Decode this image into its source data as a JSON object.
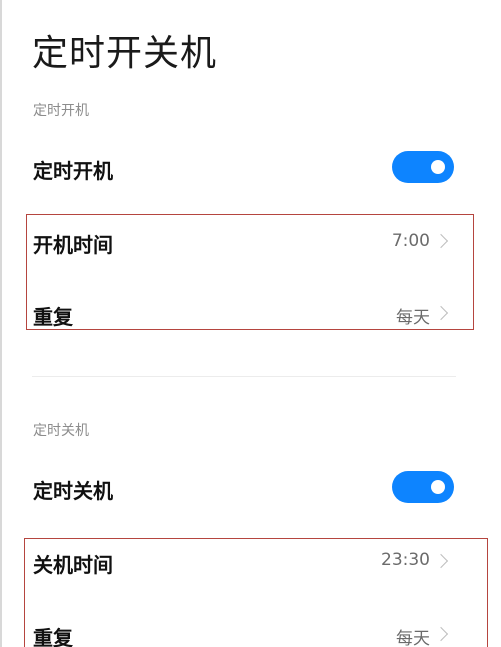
{
  "page": {
    "title": "定时开关机"
  },
  "power_on": {
    "section_label": "定时开机",
    "toggle_label": "定时开机",
    "toggle_enabled": true,
    "time_label": "开机时间",
    "time_value": "7:00",
    "repeat_label": "重复",
    "repeat_value": "每天"
  },
  "power_off": {
    "section_label": "定时关机",
    "toggle_label": "定时关机",
    "toggle_enabled": true,
    "time_label": "关机时间",
    "time_value": "23:30",
    "repeat_label": "重复",
    "repeat_value": "每天"
  },
  "colors": {
    "toggle_on": "#0d84ff",
    "highlight_border": "#b5453f",
    "section_label": "#8c8c8c",
    "value_text": "#6b6b6b"
  },
  "icons": {
    "row_arrow": "chevron-right-icon",
    "toggle_knob": "toggle-knob-icon"
  }
}
